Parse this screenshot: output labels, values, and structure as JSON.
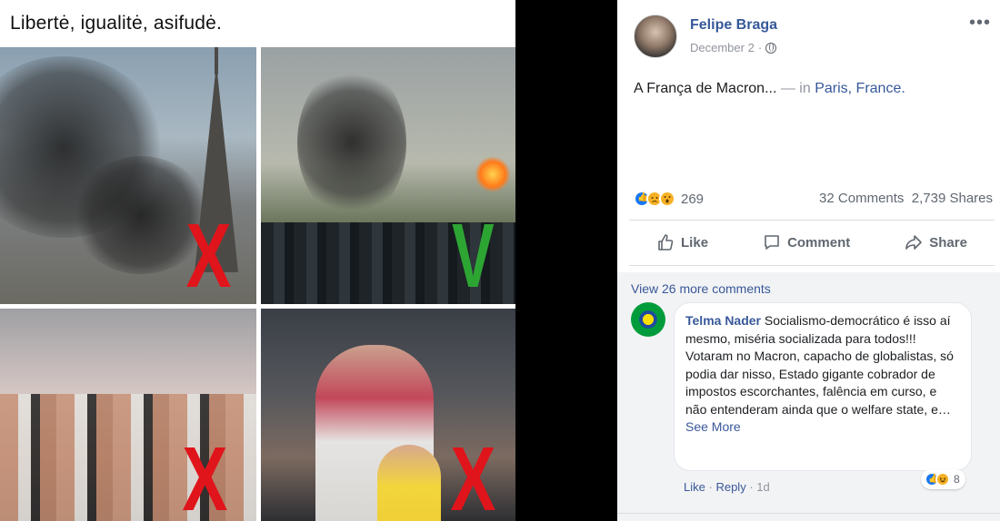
{
  "meme": {
    "caption": "Libertė, igualitė, asifudė.",
    "marks": [
      "X",
      "V",
      "X",
      "X"
    ]
  },
  "post": {
    "author": "Felipe Braga",
    "date": "December 2",
    "date_separator": "·",
    "more_icon": "more-icon",
    "status_text": "A França de Macron...",
    "status_in": " — in ",
    "status_location": "Paris, France.",
    "reaction_icons": [
      "like-reaction-icon",
      "sad-reaction-icon",
      "wow-reaction-icon"
    ],
    "reaction_count": "269",
    "comments_count": "32 Comments",
    "shares_count": "2,739 Shares"
  },
  "actions": {
    "like": "Like",
    "comment": "Comment",
    "share": "Share"
  },
  "comments": {
    "view_more": "View 26 more comments",
    "items": [
      {
        "author": "Telma Nader",
        "text": "Socialismo-democrático é isso aí mesmo, miséria socializada para todos!!!",
        "text2": "Votaram no Macron, capacho de globalistas, só podia dar nisso, Estado gigante cobrador de impostos escorchantes, falência em curso, e não entenderam ainda que o welfare state, e…",
        "see_more": "See More",
        "reaction_count": "8",
        "like_label": "Like",
        "reply_label": "Reply",
        "time": "1d",
        "separator": "·"
      }
    ]
  },
  "colors": {
    "link_blue": "#365899",
    "fb_blue": "#1877f2",
    "cross_red": "#e0141b",
    "check_green": "#2da533"
  }
}
